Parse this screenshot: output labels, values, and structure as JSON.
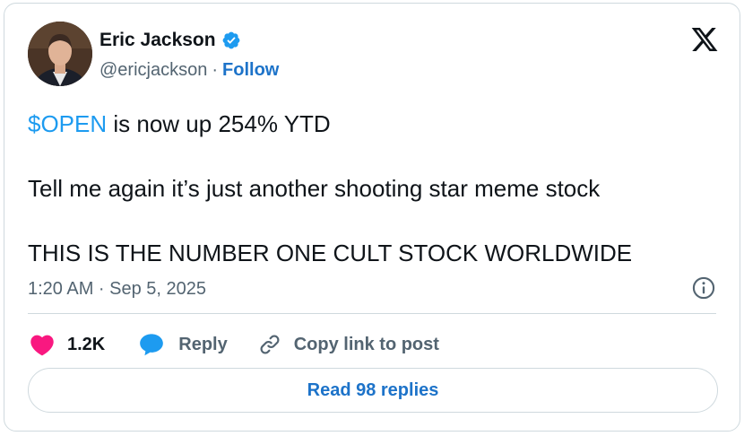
{
  "author": {
    "name": "Eric Jackson",
    "handle": "@ericjackson",
    "separator": "·",
    "follow_label": "Follow",
    "avatar_icon": "author-avatar"
  },
  "tweet": {
    "cashtag": "$OPEN",
    "line1_rest": " is now up 254% YTD",
    "line2": "Tell me again it’s just another shooting star meme stock",
    "line3": "THIS IS THE NUMBER ONE CULT STOCK WORLDWIDE"
  },
  "meta": {
    "timestamp": "1:20 AM · Sep 5, 2025"
  },
  "actions": {
    "like_count": "1.2K",
    "reply_label": "Reply",
    "copy_label": "Copy link to post"
  },
  "read_replies_label": "Read 98 replies",
  "colors": {
    "link": "#1d73c9",
    "cashtag": "#1d9bf0",
    "like": "#f91880",
    "reply": "#1d9bf0",
    "border": "#cfd9de",
    "secondary_text": "#536471"
  }
}
